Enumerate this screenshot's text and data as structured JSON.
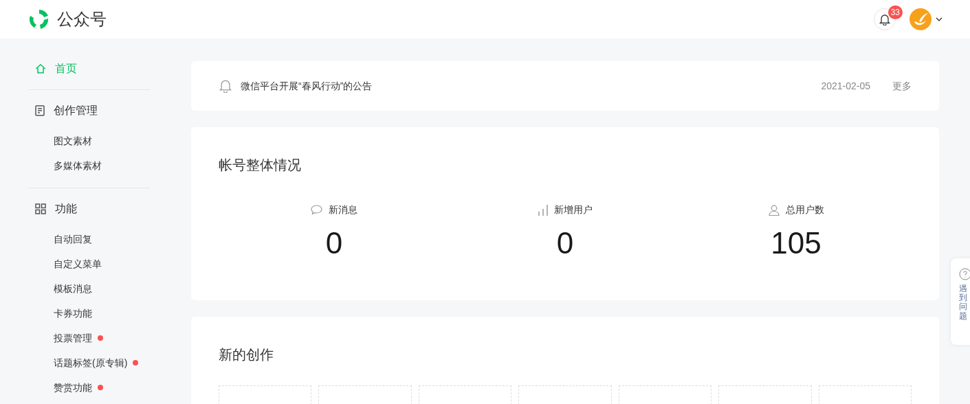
{
  "header": {
    "title": "公众号",
    "notification_count": "33"
  },
  "sidebar": {
    "sections": [
      {
        "kind": "home",
        "label": "首页",
        "selected": true
      },
      {
        "kind": "document",
        "label": "创作管理",
        "selected": false,
        "children": [
          {
            "label": "图文素材",
            "new": false
          },
          {
            "label": "多媒体素材",
            "new": false
          }
        ]
      },
      {
        "kind": "grid",
        "label": "功能",
        "selected": false,
        "children": [
          {
            "label": "自动回复",
            "new": false
          },
          {
            "label": "自定义菜单",
            "new": false
          },
          {
            "label": "模板消息",
            "new": false
          },
          {
            "label": "卡券功能",
            "new": false
          },
          {
            "label": "投票管理",
            "new": true
          },
          {
            "label": "话题标签(原专辑)",
            "new": true
          },
          {
            "label": "赞赏功能",
            "new": true
          }
        ]
      }
    ]
  },
  "announcement": {
    "text": "微信平台开展“春风行动”的公告",
    "date": "2021-02-05",
    "more": "更多"
  },
  "overview": {
    "title": "帐号整体情况",
    "stats": [
      {
        "kind": "messages",
        "label": "新消息",
        "value": "0"
      },
      {
        "kind": "new_users",
        "label": "新增用户",
        "value": "0"
      },
      {
        "kind": "total_users",
        "label": "总用户数",
        "value": "105"
      }
    ]
  },
  "creation": {
    "title": "新的创作"
  },
  "help": {
    "label": "遇到问题"
  }
}
